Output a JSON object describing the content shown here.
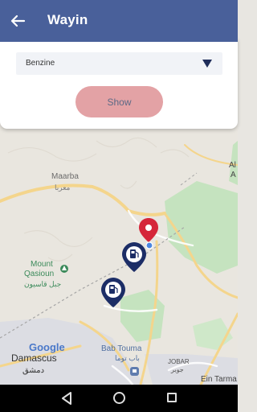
{
  "app": {
    "title": "Wayin"
  },
  "filter": {
    "selected": "Benzine",
    "button_label": "Show"
  },
  "map": {
    "labels": {
      "maarba": "Maarba",
      "maarba_ar": "معربا",
      "mount": "Mount",
      "qasioun": "Qasioun",
      "qasioun_ar": "جبل قاسيون",
      "google": "Google",
      "damascus": "Damascus",
      "damascus_ar": "دمشق",
      "bab_touma": "Bab Touma",
      "bab_touma_ar": "باب توما",
      "jobar": "JOBAR",
      "jobar_ar": "جوبر",
      "ein_tarma": "Ein Tarma",
      "edge_al": "Al",
      "edge_a": "A"
    },
    "colors": {
      "park": "#c5e3bf",
      "road": "#f5d58a",
      "pin_red": "#d5263a",
      "station_pin": "#1c2d66"
    }
  }
}
